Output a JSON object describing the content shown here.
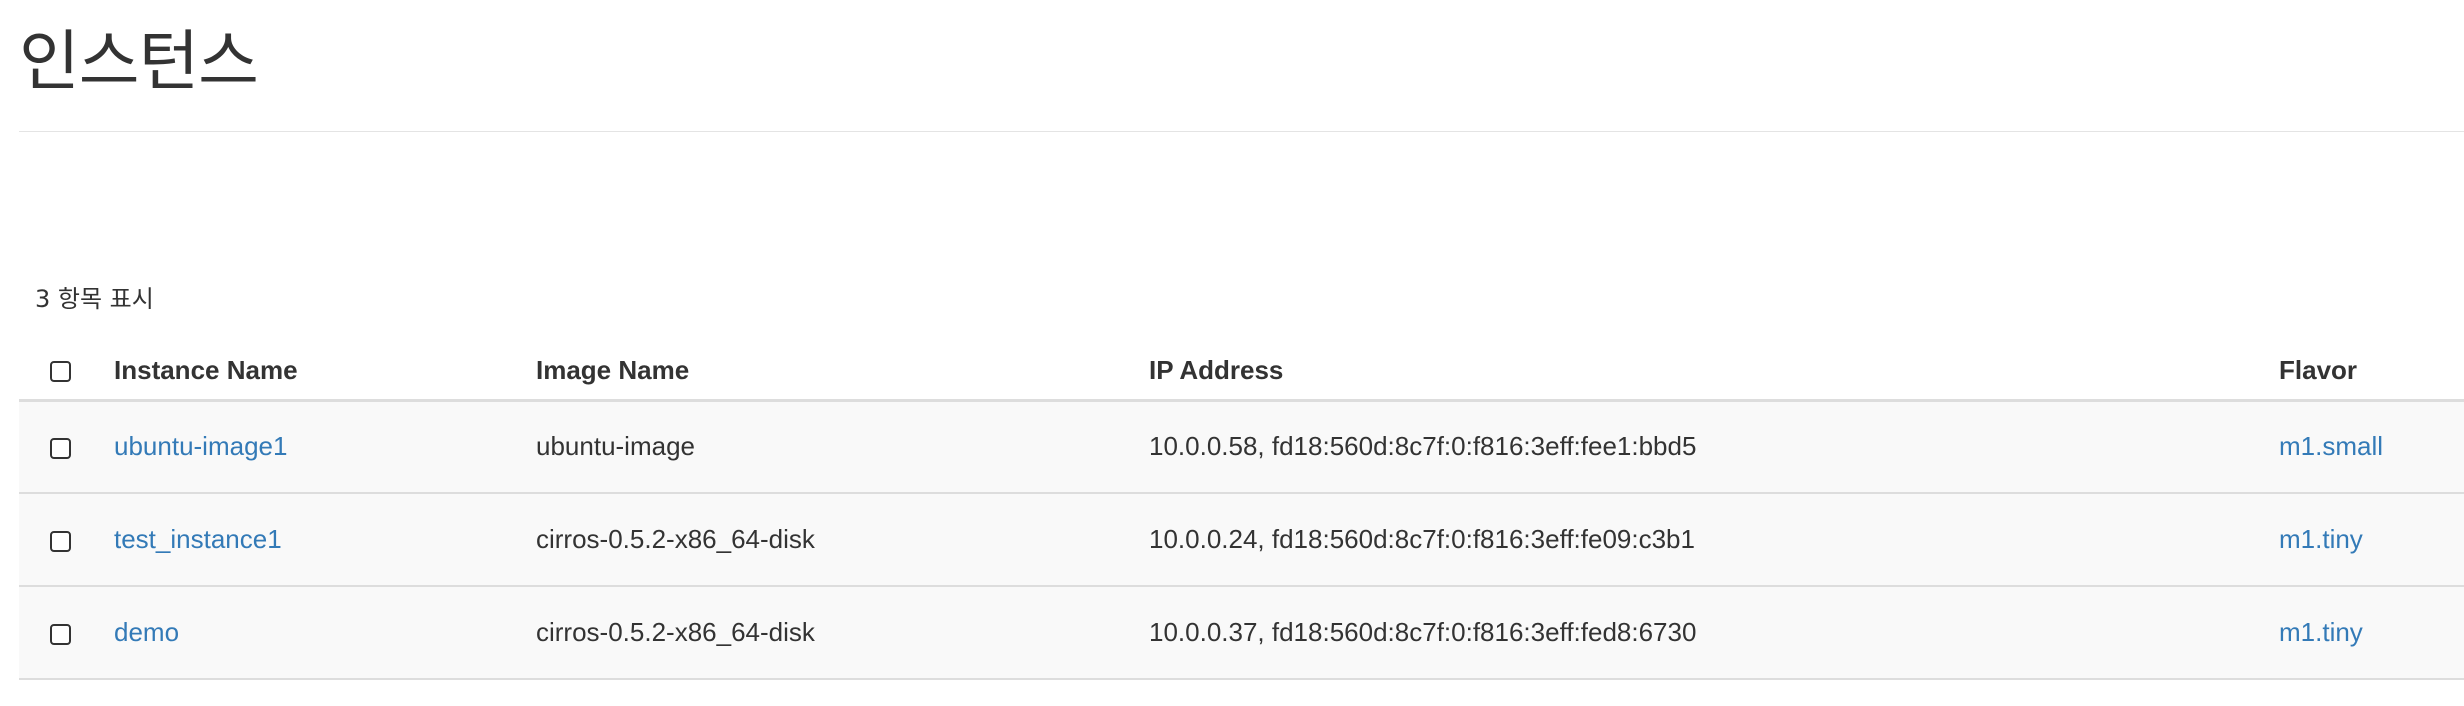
{
  "page": {
    "title": "인스턴스"
  },
  "table": {
    "item_count": "3 항목 표시",
    "columns": {
      "instance_name": "Instance Name",
      "image_name": "Image Name",
      "ip_address": "IP Address",
      "flavor": "Flavor"
    },
    "rows": [
      {
        "instance_name": "ubuntu-image1",
        "image_name": "ubuntu-image",
        "ip_address": "10.0.0.58, fd18:560d:8c7f:0:f816:3eff:fee1:bbd5",
        "flavor": "m1.small"
      },
      {
        "instance_name": "test_instance1",
        "image_name": "cirros-0.5.2-x86_64-disk",
        "ip_address": "10.0.0.24, fd18:560d:8c7f:0:f816:3eff:fe09:c3b1",
        "flavor": "m1.tiny"
      },
      {
        "instance_name": "demo",
        "image_name": "cirros-0.5.2-x86_64-disk",
        "ip_address": "10.0.0.37, fd18:560d:8c7f:0:f816:3eff:fed8:6730",
        "flavor": "m1.tiny"
      }
    ]
  },
  "colors": {
    "link": "#337ab7",
    "text": "#333333",
    "row_background": "#f9f9f9",
    "border": "#dddddd"
  }
}
